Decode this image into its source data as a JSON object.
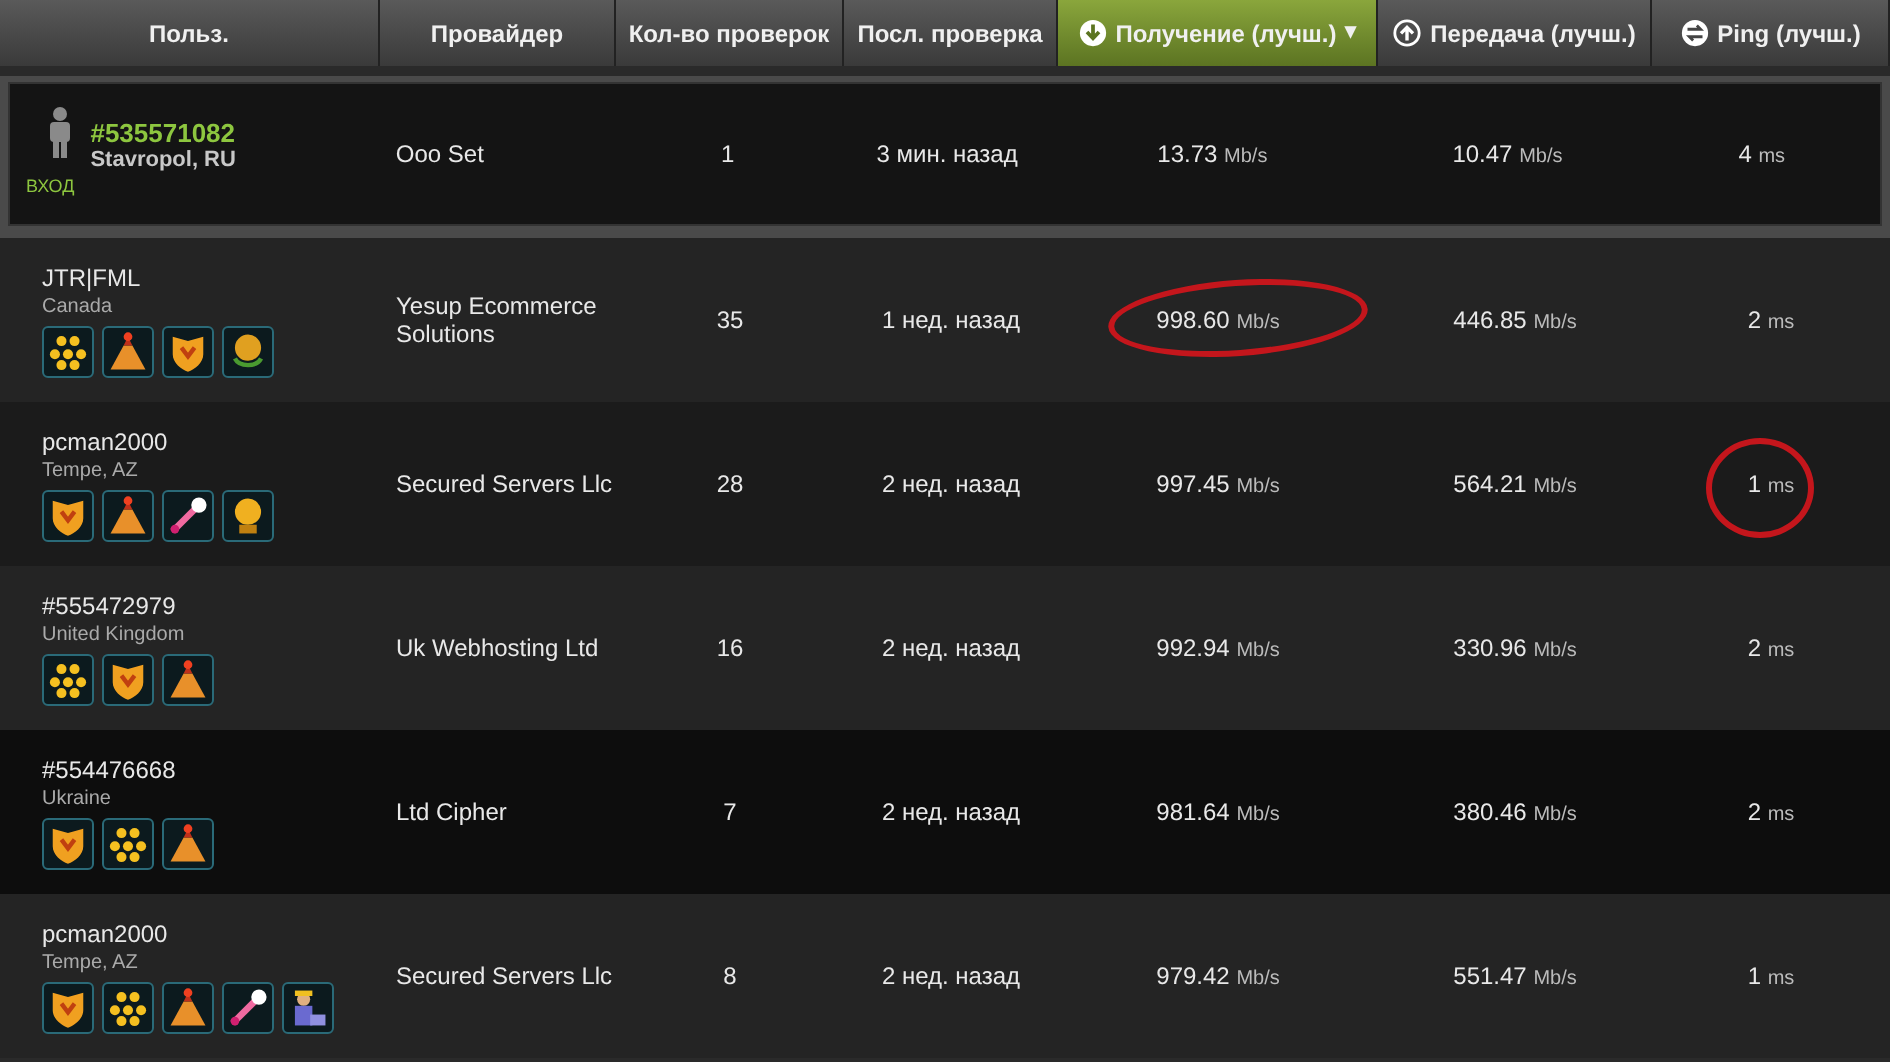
{
  "columns": [
    {
      "label": "Польз.",
      "selected": false
    },
    {
      "label": "Провайдер",
      "selected": false
    },
    {
      "label": "Кол-во проверок",
      "selected": false
    },
    {
      "label": "Посл. проверка",
      "selected": false
    },
    {
      "label": "Получение (лучш.)",
      "selected": true,
      "kind": "download",
      "sort_mark": "▾"
    },
    {
      "label": "Передача (лучш.)",
      "selected": false,
      "kind": "upload"
    },
    {
      "label": "Ping (лучш.)",
      "selected": false,
      "kind": "ping"
    }
  ],
  "own_result": {
    "user": "#535571082",
    "location": "Stavropol, RU",
    "login": "ВХОД",
    "provider": "Ooo Set",
    "tests": "1",
    "last_test": "3 мин. назад",
    "download": "13.73",
    "download_unit": "Mb/s",
    "upload": "10.47",
    "upload_unit": "Mb/s",
    "ping": "4",
    "ping_unit": "ms"
  },
  "rows": [
    {
      "user": "JTR|FML",
      "location": "Canada",
      "badges": [
        {
          "kind": "stars"
        },
        {
          "kind": "volcano"
        },
        {
          "kind": "shield"
        },
        {
          "kind": "medal"
        }
      ],
      "provider": "Yesup Ecommerce Solutions",
      "tests": "35",
      "last_test": "1 нед. назад",
      "download": "998.60",
      "download_unit": "Mb/s",
      "upload": "446.85",
      "upload_unit": "Mb/s",
      "ping": "2",
      "ping_unit": "ms",
      "download_circled": true
    },
    {
      "user": "pcman2000",
      "location": "Tempe, AZ",
      "badges": [
        {
          "kind": "shield"
        },
        {
          "kind": "volcano"
        },
        {
          "kind": "rocket"
        },
        {
          "kind": "trophy"
        }
      ],
      "provider": "Secured Servers Llc",
      "tests": "28",
      "last_test": "2 нед. назад",
      "download": "997.45",
      "download_unit": "Mb/s",
      "upload": "564.21",
      "upload_unit": "Mb/s",
      "ping": "1",
      "ping_unit": "ms",
      "ping_circled": true
    },
    {
      "user": "#555472979",
      "location": "United Kingdom",
      "badges": [
        {
          "kind": "stars"
        },
        {
          "kind": "shield"
        },
        {
          "kind": "volcano"
        }
      ],
      "provider": "Uk Webhosting Ltd",
      "tests": "16",
      "last_test": "2 нед. назад",
      "download": "992.94",
      "download_unit": "Mb/s",
      "upload": "330.96",
      "upload_unit": "Mb/s",
      "ping": "2",
      "ping_unit": "ms"
    },
    {
      "user": "#554476668",
      "location": "Ukraine",
      "badges": [
        {
          "kind": "shield"
        },
        {
          "kind": "stars"
        },
        {
          "kind": "volcano"
        }
      ],
      "provider": "Ltd Cipher",
      "tests": "7",
      "last_test": "2 нед. назад",
      "download": "981.64",
      "download_unit": "Mb/s",
      "upload": "380.46",
      "upload_unit": "Mb/s",
      "ping": "2",
      "ping_unit": "ms"
    },
    {
      "user": "pcman2000",
      "location": "Tempe, AZ",
      "badges": [
        {
          "kind": "shield"
        },
        {
          "kind": "stars"
        },
        {
          "kind": "volcano"
        },
        {
          "kind": "rocket"
        },
        {
          "kind": "worker"
        }
      ],
      "provider": "Secured Servers Llc",
      "tests": "8",
      "last_test": "2 нед. назад",
      "download": "979.42",
      "download_unit": "Mb/s",
      "upload": "551.47",
      "upload_unit": "Mb/s",
      "ping": "1",
      "ping_unit": "ms"
    }
  ]
}
